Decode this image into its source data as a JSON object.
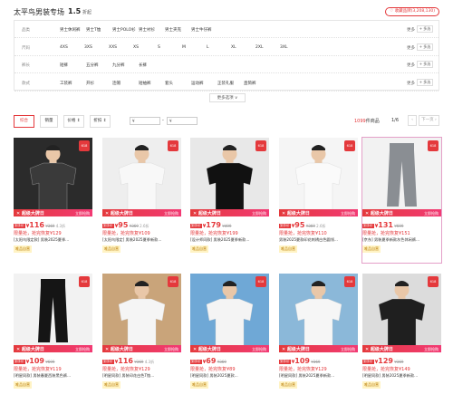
{
  "header": {
    "title": "太平鸟男装专场",
    "discount": "1.5",
    "discount_unit": "折起",
    "fav_button": "收藏品牌(3,208,130)"
  },
  "filters": [
    {
      "label": "品类",
      "options": [
        "男士休闲裤",
        "男士T恤",
        "男士POLO衫",
        "男士衬衫",
        "男士夹克",
        "男士牛仔裤"
      ]
    },
    {
      "label": "尺码",
      "options": [
        "4XS",
        "3XS",
        "XXS",
        "XS",
        "S",
        "M",
        "L",
        "XL",
        "2XL",
        "3XL"
      ]
    },
    {
      "label": "裤长",
      "options": [
        "短裤",
        "五分裤",
        "九分裤",
        "长裤"
      ]
    },
    {
      "label": "款式",
      "options": [
        "工装裤",
        "开衫",
        "连帽",
        "短袖裤",
        "套头",
        "运动裤",
        "正装礼服",
        "直筒裤"
      ]
    }
  ],
  "filter_more": "更多",
  "filter_multi": "+ 多选",
  "more_options": "更多选项 ∨",
  "sort": {
    "items": [
      "综合",
      "销量",
      "价格 ↕",
      "折扣 ↕"
    ],
    "price_min": "¥",
    "price_max": "¥",
    "count_num": "1099",
    "count_suffix": "件商品",
    "page": "1/6",
    "prev": "‹",
    "next": "下一页 ›"
  },
  "banner_left": "✕ 超级大牌日",
  "banner_right": "立即抢购",
  "price_tag": "到手价",
  "yen": "¥",
  "shop_tag": "唯品自营",
  "cards": [
    {
      "price": "116",
      "orig": "¥369",
      "disc": "4.3折",
      "promo": "限量抢，抢完恢复¥129",
      "title": "[太阳鸟限定款] 男装2025夏季...",
      "bg": "#2b2b2b",
      "shirt": "#3a3a3a"
    },
    {
      "price": "95",
      "orig": "¥369",
      "disc": "2.6折",
      "promo": "限量抢，抢完恢复¥109",
      "title": "[太阳鸟限定] 男装2025夏季新款...",
      "bg": "#eeeeee",
      "shirt": "#f8f8f8"
    },
    {
      "price": "179",
      "orig": "¥499",
      "disc": "",
      "promo": "限量抢，抢完恢复¥199",
      "title": "[设计师同款] 男装2025夏季新款...",
      "bg": "#e8e8e8",
      "shirt": "#111111"
    },
    {
      "price": "95",
      "orig": "¥369",
      "disc": "2.6折",
      "promo": "限量抢，抢完恢复¥110",
      "title": "男装2025夏款印花刺绣白色圆领...",
      "bg": "#f5f5f5",
      "shirt": "#fafafa"
    },
    {
      "price": "131",
      "orig": "¥699",
      "disc": "",
      "promo": "限量抢，抢完恢复¥151",
      "title": "[京东] 男装夏季新款灰色休闲裤...",
      "bg": "#f2f2f2",
      "shirt": "#8a8e93"
    },
    {
      "price": "109",
      "orig": "¥699",
      "disc": "",
      "promo": "限量抢，抢完恢复¥119",
      "title": "[明星同款] 男装春夏西装黑色裤...",
      "bg": "#f2f2f2",
      "shirt": "#151515"
    },
    {
      "price": "116",
      "orig": "¥369",
      "disc": "4.3折",
      "promo": "限量抢，抢完恢复¥129",
      "title": "[明星同款] 男装印花白色T恤...",
      "bg": "#c9a47a",
      "shirt": "#f5f5f5"
    },
    {
      "price": "69",
      "orig": "¥369",
      "disc": "",
      "promo": "限量抢，抢完恢复¥89",
      "title": "[明星同款] 男装2025夏款...",
      "bg": "#6fa8d6",
      "shirt": "#f4f4f4"
    },
    {
      "price": "109",
      "orig": "¥369",
      "disc": "",
      "promo": "限量抢，抢完恢复¥129",
      "title": "[明星同款] 男装2025夏季新款...",
      "bg": "#8bb8d9",
      "shirt": "#f6f6f6"
    },
    {
      "price": "129",
      "orig": "¥369",
      "disc": "",
      "promo": "限量抢，抢完恢复¥149",
      "title": "[明星同款] 男装2025夏季新款...",
      "bg": "#dcdcdc",
      "shirt": "#1f1f1f"
    }
  ],
  "colors": {
    "accent": "#e4393c",
    "pink": "#f23a74"
  }
}
